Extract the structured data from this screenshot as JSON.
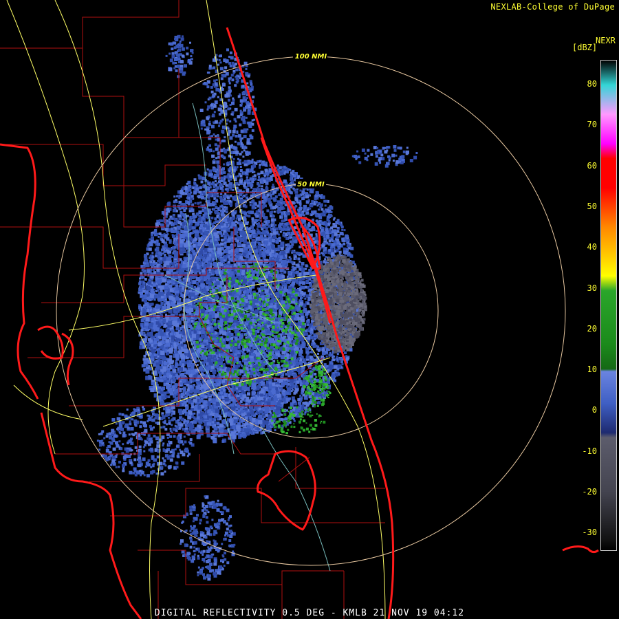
{
  "credit": "NEXLAB-College of DuPage",
  "legend": {
    "product": "NEXR",
    "unit": "[dBZ]",
    "ticks": [
      "80",
      "70",
      "60",
      "50",
      "40",
      "30",
      "20",
      "10",
      "0",
      "-10",
      "-20",
      "-30"
    ],
    "colors": {
      "clear": "#000000",
      "gray": "#5c5c6c",
      "blue": "#3f5fc4",
      "green": "#2aa62a",
      "yellow": "#ffff00",
      "red": "#ff0000",
      "magenta": "#ff00ff",
      "cyan": "#33d6d6"
    }
  },
  "rings": [
    {
      "label": "100 NMI",
      "range_nmi": 100
    },
    {
      "label": "50 NMI",
      "range_nmi": 50
    }
  ],
  "footer": "DIGITAL REFLECTIVITY 0.5 DEG - KMLB 21 NOV 19 04:12",
  "map_colors": {
    "coast": "#ff1a1a",
    "county": "#b01010",
    "roads": "#ffff66",
    "rivers": "#77bbbb",
    "rings": "#e8c8a0"
  }
}
